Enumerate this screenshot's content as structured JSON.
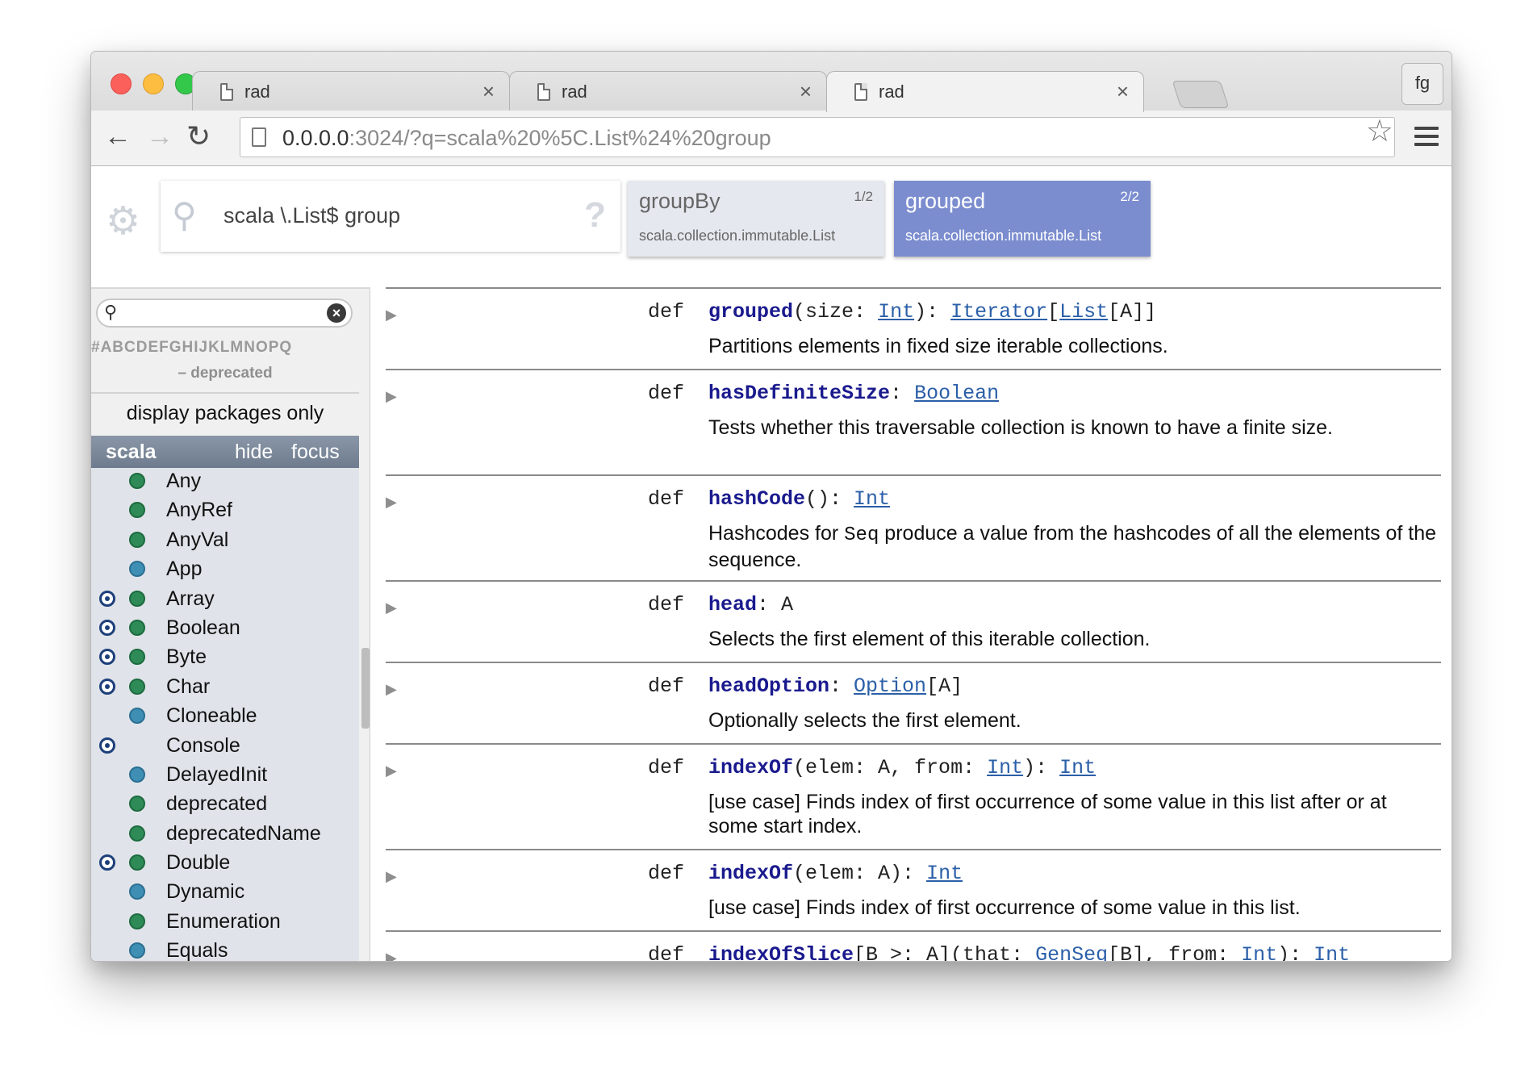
{
  "browser": {
    "tabs": [
      {
        "title": "rad",
        "close": "×"
      },
      {
        "title": "rad",
        "close": "×"
      },
      {
        "title": "rad",
        "close": "×"
      }
    ],
    "profile": "fg",
    "nav": {
      "back": "←",
      "forward": "→",
      "reload": "↻"
    },
    "url": {
      "host": "0.0.0.0",
      "rest": ":3024/?q=scala%20%5C.List%24%20group"
    }
  },
  "search": {
    "query": "scala \\.List$ group",
    "help": "?"
  },
  "results": [
    {
      "name": "groupBy",
      "count": "1/2",
      "path": "scala.collection.immutable.List"
    },
    {
      "name": "grouped",
      "count": "2/2",
      "path": "scala.collection.immutable.List"
    }
  ],
  "sidebar": {
    "letters": "#ABCDEFGHIJKLMNOPQ",
    "deprecated": "– deprecated",
    "display_packages": "display packages only",
    "package": {
      "name": "scala",
      "hide": "hide",
      "focus": "focus"
    },
    "entities": [
      {
        "name": "Any",
        "object": false,
        "kind": "class"
      },
      {
        "name": "AnyRef",
        "object": false,
        "kind": "class"
      },
      {
        "name": "AnyVal",
        "object": false,
        "kind": "class"
      },
      {
        "name": "App",
        "object": false,
        "kind": "trait"
      },
      {
        "name": "Array",
        "object": true,
        "kind": "class"
      },
      {
        "name": "Boolean",
        "object": true,
        "kind": "class"
      },
      {
        "name": "Byte",
        "object": true,
        "kind": "class"
      },
      {
        "name": "Char",
        "object": true,
        "kind": "class"
      },
      {
        "name": "Cloneable",
        "object": false,
        "kind": "trait"
      },
      {
        "name": "Console",
        "object": true,
        "kind": "none"
      },
      {
        "name": "DelayedInit",
        "object": false,
        "kind": "trait"
      },
      {
        "name": "deprecated",
        "object": false,
        "kind": "class"
      },
      {
        "name": "deprecatedName",
        "object": false,
        "kind": "class"
      },
      {
        "name": "Double",
        "object": true,
        "kind": "class"
      },
      {
        "name": "Dynamic",
        "object": false,
        "kind": "trait"
      },
      {
        "name": "Enumeration",
        "object": false,
        "kind": "class"
      },
      {
        "name": "Equals",
        "object": false,
        "kind": "trait"
      }
    ]
  },
  "members": [
    {
      "keyword": "def",
      "name": "grouped",
      "parts": [
        [
          "t",
          "(size: "
        ],
        [
          "l",
          "Int"
        ],
        [
          "t",
          "): "
        ],
        [
          "l",
          "Iterator"
        ],
        [
          "t",
          "["
        ],
        [
          "l",
          "List"
        ],
        [
          "t",
          "[A]]"
        ]
      ],
      "desc": "Partitions elements in fixed size iterable collections."
    },
    {
      "keyword": "def",
      "name": "hasDefiniteSize",
      "parts": [
        [
          "t",
          ": "
        ],
        [
          "l",
          "Boolean"
        ]
      ],
      "desc": "Tests whether this traversable collection is known to have a finite size."
    },
    {
      "keyword": "def",
      "name": "hashCode",
      "parts": [
        [
          "t",
          "(): "
        ],
        [
          "l",
          "Int"
        ]
      ],
      "desc_parts": [
        [
          "t",
          "Hashcodes for "
        ],
        [
          "c",
          "Seq"
        ],
        [
          "t",
          " produce a value from the hashcodes of all the elements of the sequence."
        ]
      ]
    },
    {
      "keyword": "def",
      "name": "head",
      "parts": [
        [
          "t",
          ": A"
        ]
      ],
      "desc": "Selects the first element of this iterable collection."
    },
    {
      "keyword": "def",
      "name": "headOption",
      "parts": [
        [
          "t",
          ": "
        ],
        [
          "l",
          "Option"
        ],
        [
          "t",
          "[A]"
        ]
      ],
      "desc": "Optionally selects the first element."
    },
    {
      "keyword": "def",
      "name": "indexOf",
      "parts": [
        [
          "t",
          "(elem: A, from: "
        ],
        [
          "l",
          "Int"
        ],
        [
          "t",
          "): "
        ],
        [
          "l",
          "Int"
        ]
      ],
      "desc": "[use case] Finds index of first occurrence of some value in this list after or at some start index."
    },
    {
      "keyword": "def",
      "name": "indexOf",
      "parts": [
        [
          "t",
          "(elem: A): "
        ],
        [
          "l",
          "Int"
        ]
      ],
      "desc": "[use case] Finds index of first occurrence of some value in this list."
    },
    {
      "keyword": "def",
      "name": "indexOfSlice",
      "parts": [
        [
          "t",
          "[B >: A](that: "
        ],
        [
          "l",
          "GenSeq"
        ],
        [
          "t",
          "[B], from: "
        ],
        [
          "l",
          "Int"
        ],
        [
          "t",
          "): "
        ],
        [
          "l",
          "Int"
        ]
      ],
      "desc": ""
    }
  ]
}
